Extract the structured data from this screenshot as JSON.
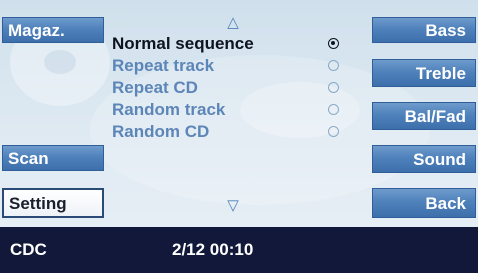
{
  "left_buttons": {
    "magazine": "Magaz.",
    "scan": "Scan",
    "setting": "Setting"
  },
  "right_buttons": {
    "bass": "Bass",
    "treble": "Treble",
    "balance_fader": "Bal/Fad",
    "sound": "Sound",
    "back": "Back"
  },
  "list": {
    "up_icon": "up-triangle-icon",
    "down_icon": "down-triangle-icon",
    "options": [
      {
        "label": "Normal sequence",
        "selected": true
      },
      {
        "label": "Repeat track",
        "selected": false
      },
      {
        "label": "Repeat CD",
        "selected": false
      },
      {
        "label": "Random track",
        "selected": false
      },
      {
        "label": "Random CD",
        "selected": false
      }
    ]
  },
  "status_bar": {
    "source": "CDC",
    "track_time": "2/12 00:10"
  },
  "colors": {
    "button": "#4f81bb",
    "status_bar": "#12183a",
    "inactive_text": "#5d86b8"
  }
}
